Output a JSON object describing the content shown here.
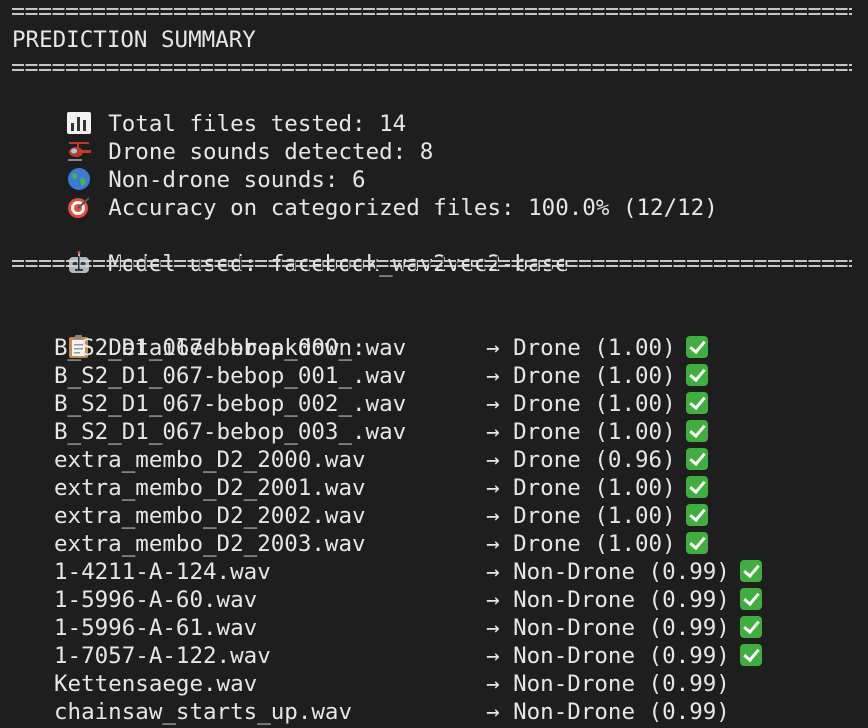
{
  "separator": "==================================================================",
  "summary": {
    "title": "PREDICTION SUMMARY",
    "total": {
      "icon": "bar-chart-icon",
      "text": "Total files tested: 14"
    },
    "drone": {
      "icon": "helicopter-icon",
      "text": "Drone sounds detected: 8"
    },
    "nondrone": {
      "icon": "globe-icon",
      "text": "Non-drone sounds: 6"
    },
    "accuracy": {
      "icon": "target-icon",
      "text": "Accuracy on categorized files: 100.0% (12/12)"
    },
    "model": {
      "icon": "robot-icon",
      "text": "Model used: facebook_wav2vec2-base"
    }
  },
  "breakdown": {
    "icon": "clipboard-icon",
    "heading": "Detailed breakdown:",
    "rows": [
      {
        "file": "B_S2_D1_067-bebop_000_.wav",
        "result": "→ Drone (1.00)",
        "correct": true
      },
      {
        "file": "B_S2_D1_067-bebop_001_.wav",
        "result": "→ Drone (1.00)",
        "correct": true
      },
      {
        "file": "B_S2_D1_067-bebop_002_.wav",
        "result": "→ Drone (1.00)",
        "correct": true
      },
      {
        "file": "B_S2_D1_067-bebop_003_.wav",
        "result": "→ Drone (1.00)",
        "correct": true
      },
      {
        "file": "extra_membo_D2_2000.wav",
        "result": "→ Drone (0.96)",
        "correct": true
      },
      {
        "file": "extra_membo_D2_2001.wav",
        "result": "→ Drone (1.00)",
        "correct": true
      },
      {
        "file": "extra_membo_D2_2002.wav",
        "result": "→ Drone (1.00)",
        "correct": true
      },
      {
        "file": "extra_membo_D2_2003.wav",
        "result": "→ Drone (1.00)",
        "correct": true
      },
      {
        "file": "1-4211-A-124.wav",
        "result": "→ Non-Drone (0.99)",
        "correct": true
      },
      {
        "file": "1-5996-A-60.wav",
        "result": "→ Non-Drone (0.99)",
        "correct": true
      },
      {
        "file": "1-5996-A-61.wav",
        "result": "→ Non-Drone (0.99)",
        "correct": true
      },
      {
        "file": "1-7057-A-122.wav",
        "result": "→ Non-Drone (0.99)",
        "correct": true
      },
      {
        "file": "Kettensaege.wav",
        "result": "→ Non-Drone (0.99)",
        "correct": false
      },
      {
        "file": "chainsaw_starts_up.wav",
        "result": "→ Non-Drone (0.99)",
        "correct": false
      }
    ]
  },
  "colors": {
    "background": "#1e1e1e",
    "text": "#e6e6e6",
    "check": "#3fae3f"
  }
}
